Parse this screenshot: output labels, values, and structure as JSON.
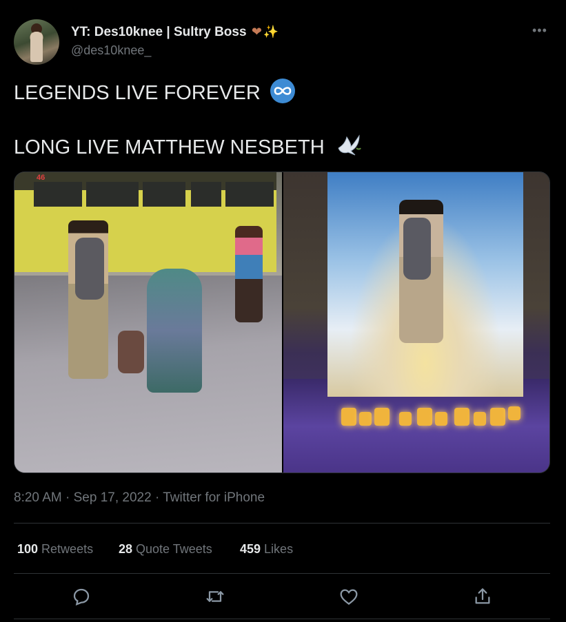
{
  "author": {
    "display_name": "YT: Des10knee | Sultry Boss",
    "name_emojis": [
      "heart-icon-brown",
      "sparkles-icon"
    ],
    "handle": "@des10knee_"
  },
  "tweet": {
    "line1": "LEGENDS LIVE FOREVER",
    "line1_emoji": "infinity-icon",
    "line2": "LONG LIVE MATTHEW NESBETH",
    "line2_emoji": "dove-icon"
  },
  "media": {
    "left_photo": {
      "bus_number": "46"
    },
    "right_photo": {}
  },
  "meta": {
    "time": "8:20 AM",
    "separator": "·",
    "date": "Sep 17, 2022",
    "source": "Twitter for iPhone"
  },
  "stats": {
    "retweets_count": "100",
    "retweets_label": "Retweets",
    "quotes_count": "28",
    "quotes_label": "Quote Tweets",
    "likes_count": "459",
    "likes_label": "Likes"
  },
  "actions": [
    "reply-icon",
    "retweet-icon",
    "like-icon",
    "share-icon"
  ],
  "colors": {
    "background": "#000000",
    "text": "#e7e9ea",
    "secondary": "#71767b",
    "divider": "#2f3336",
    "infinity_badge": "#3d8bd4"
  }
}
